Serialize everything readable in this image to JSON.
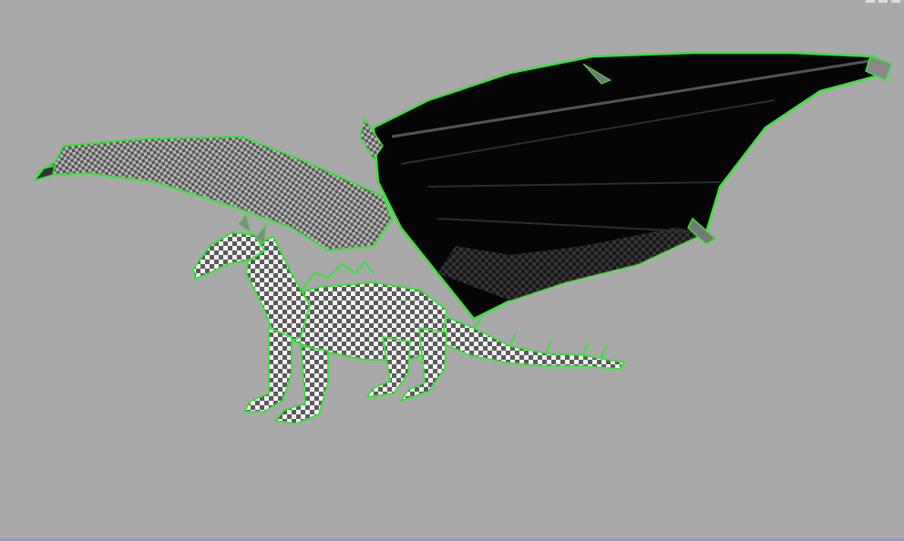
{
  "viewport": {
    "background": "#a9a9a9",
    "outline_color": "#39e23a",
    "checker_light": "#f2f2f2",
    "checker_dark": "#5a5a5a",
    "wing_membrane": "#050505"
  },
  "model": {
    "icon": "dragon-model-icon",
    "selected": true
  },
  "status": {
    "bar_color": "#8a9fc6"
  }
}
